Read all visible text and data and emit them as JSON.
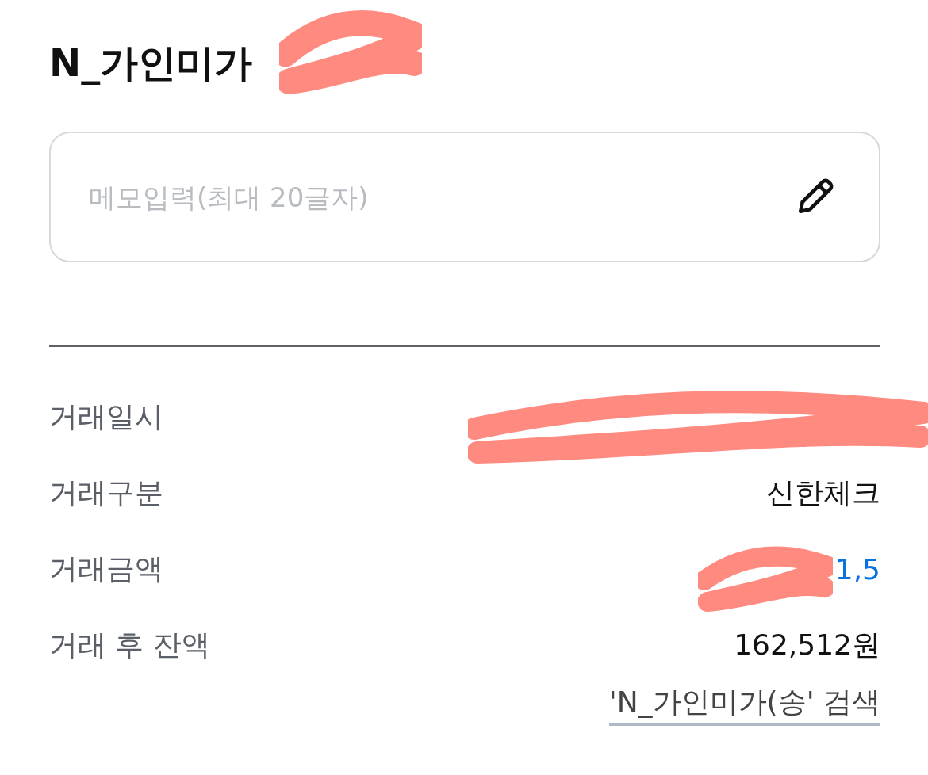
{
  "title": {
    "text": "N_가인미가",
    "redacted": true
  },
  "memo": {
    "placeholder": "메모입력(최대 20글자)"
  },
  "details": [
    {
      "label": "거래일시",
      "kind": "plain",
      "redacted": true
    },
    {
      "label": "거래구분",
      "value": "신한체크",
      "kind": "plain",
      "redacted": false
    },
    {
      "label": "거래금액",
      "value": "1,5",
      "kind": "amount",
      "redacted": true
    },
    {
      "label": "거래 후 잔액",
      "value": "162,512원",
      "kind": "plain",
      "redacted": false
    }
  ],
  "search_link": "'N_가인미가(송' 검색"
}
